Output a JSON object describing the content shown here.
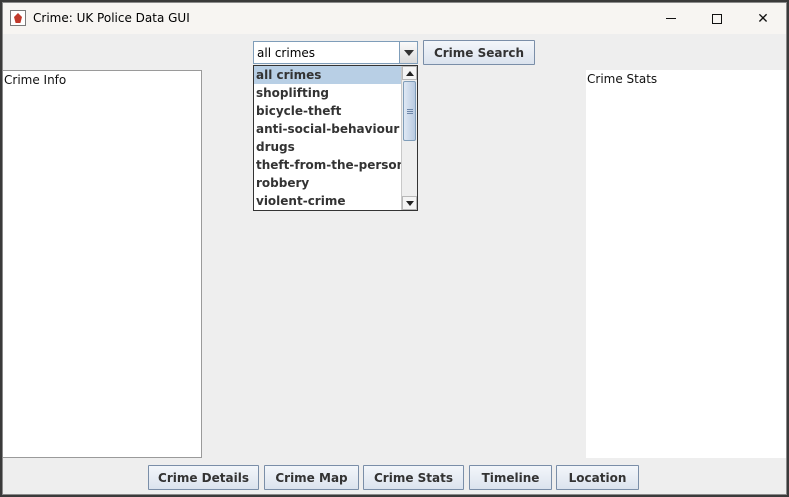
{
  "window": {
    "title": "Crime: UK Police Data GUI",
    "icon": "police-app-icon",
    "controls": [
      "minimize-icon",
      "maximize-icon",
      "close-icon"
    ]
  },
  "filter": {
    "selected": "all crimes",
    "search_button": "Crime Search",
    "options": [
      "all crimes",
      "shoplifting",
      "bicycle-theft",
      "anti-social-behaviour",
      "drugs",
      "theft-from-the-person",
      "robbery",
      "violent-crime"
    ],
    "highlighted_index": 0
  },
  "panels": {
    "left_label": "Crime Info",
    "right_label": "Crime Stats"
  },
  "bottom_buttons": {
    "details": "Crime Details",
    "map": "Crime Map",
    "stats": "Crime Stats",
    "timeline": "Timeline",
    "location": "Location"
  },
  "colors": {
    "window_bg": "#eeeeee",
    "selection": "#b8cfe5",
    "button_border": "#7a8ea8"
  }
}
